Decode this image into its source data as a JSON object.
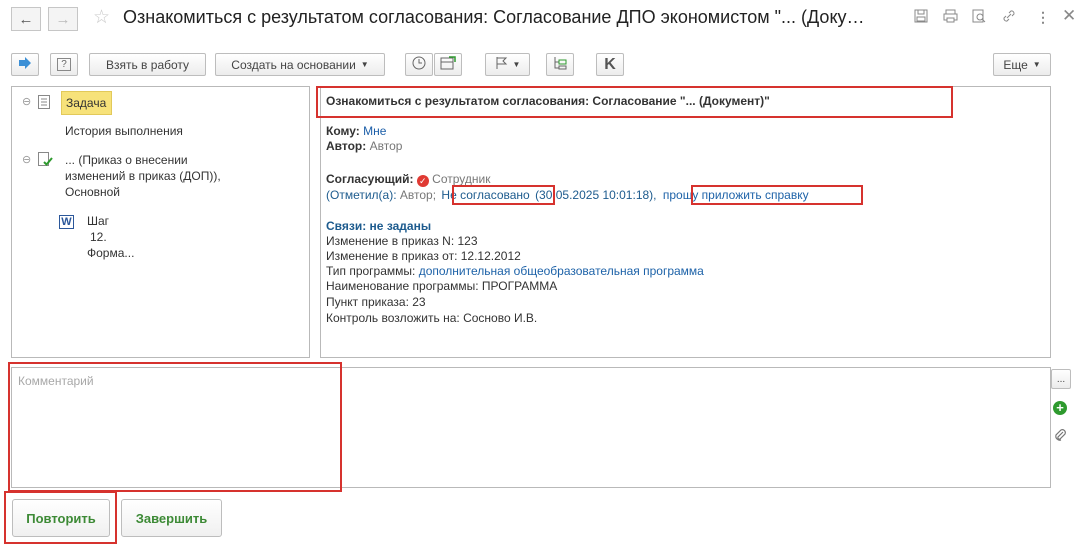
{
  "window": {
    "title": "Ознакомиться с результатом согласования: Согласование ДПО экономистом \"... (Доку…"
  },
  "toolbar": {
    "take_to_work": "Взять в работу",
    "create_based_on": "Создать на основании",
    "k_label": "K",
    "more": "Еще"
  },
  "tree": {
    "task": "Задача",
    "history": "История выполнения",
    "doc_line1": "... (Приказ о внесении",
    "doc_line2": "изменений в приказ (ДОП)),",
    "doc_line3": "Основной",
    "step_line1": "Шаг",
    "step_line2": "12.",
    "step_line3": "Форма..."
  },
  "details": {
    "header": "Ознакомиться с результатом согласования: Согласование  \"... (Документ)\"",
    "to_label": "Кому:",
    "to_value": "Мне",
    "author_label": "Автор:",
    "author_value": "Автор",
    "approver_label": "Согласующий:",
    "approver_value": "Сотрудник",
    "marked_prefix": "(Отметил(а):",
    "marked_author": "Автор;",
    "status": "Не согласовано",
    "date": "(30.05.2025 10:01:18),",
    "comment_link": "прошу приложить справку",
    "links": "Связи: не заданы",
    "order_no": "Изменение в приказ N: 123",
    "order_date": "Изменение в приказ от: 12.12.2012",
    "program_type_label": "Тип программы:",
    "program_type_value": "дополнительная общеобразовательная программа",
    "program_name": "Наименование программы: ПРОГРАММА",
    "order_item": "Пункт приказа: 23",
    "control": "Контроль возложить на: Сосново И.В."
  },
  "comment": {
    "placeholder": "Комментарий",
    "more": "..."
  },
  "actions": {
    "repeat": "Повторить",
    "finish": "Завершить"
  },
  "colors": {
    "highlight": "#d6322e",
    "task_bg": "#f7e27a",
    "action_green": "#3d8a36",
    "link_blue": "#1d62a8"
  }
}
